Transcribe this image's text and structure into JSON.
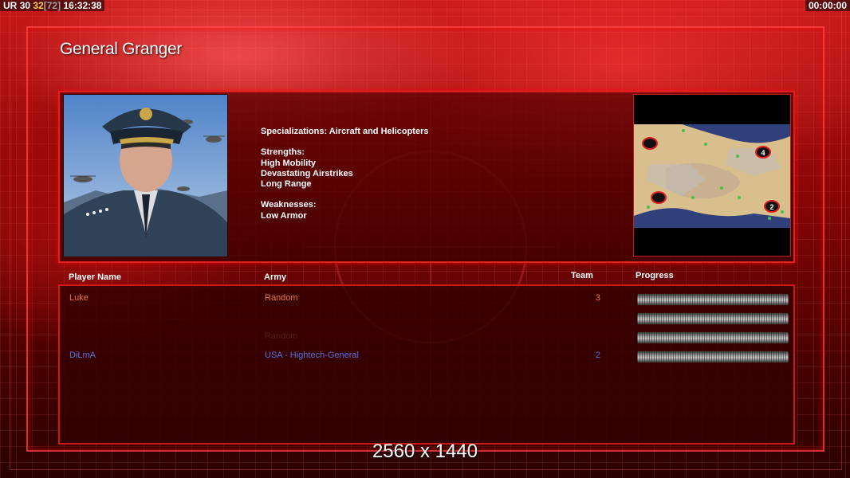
{
  "hud": {
    "left_prefix": "UR",
    "fps": "30",
    "fps_target": "32",
    "fps_bracket": "[72]",
    "clock": "16:32:38",
    "timer": "00:00:00"
  },
  "general": {
    "name": "General Granger",
    "specializations": "Specializations: Aircraft and Helicopters",
    "strengths_label": "Strengths:",
    "strengths": [
      "High Mobility",
      "Devastating Airstrikes",
      "Long Range"
    ],
    "weaknesses_label": "Weaknesses:",
    "weaknesses": [
      "Low Armor"
    ]
  },
  "minimap": {
    "markers": [
      {
        "label": ""
      },
      {
        "label": "4"
      },
      {
        "label": ""
      },
      {
        "label": "2"
      }
    ]
  },
  "table": {
    "headers": {
      "player": "Player Name",
      "army": "Army",
      "team": "Team",
      "progress": "Progress"
    },
    "rows": [
      {
        "name": "Luke",
        "army": "Random",
        "team": "3",
        "color": "#e07a2a"
      },
      {
        "name": "",
        "army": "",
        "team": "",
        "color": "#5a1a12"
      },
      {
        "name": "",
        "army": "Random",
        "team": "",
        "color": "#5a1a12"
      },
      {
        "name": "DiLmA",
        "army": "USA - Hightech-General",
        "team": "2",
        "color": "#5a6ee0"
      }
    ]
  },
  "overlay": {
    "resolution": "2560 x 1440"
  }
}
